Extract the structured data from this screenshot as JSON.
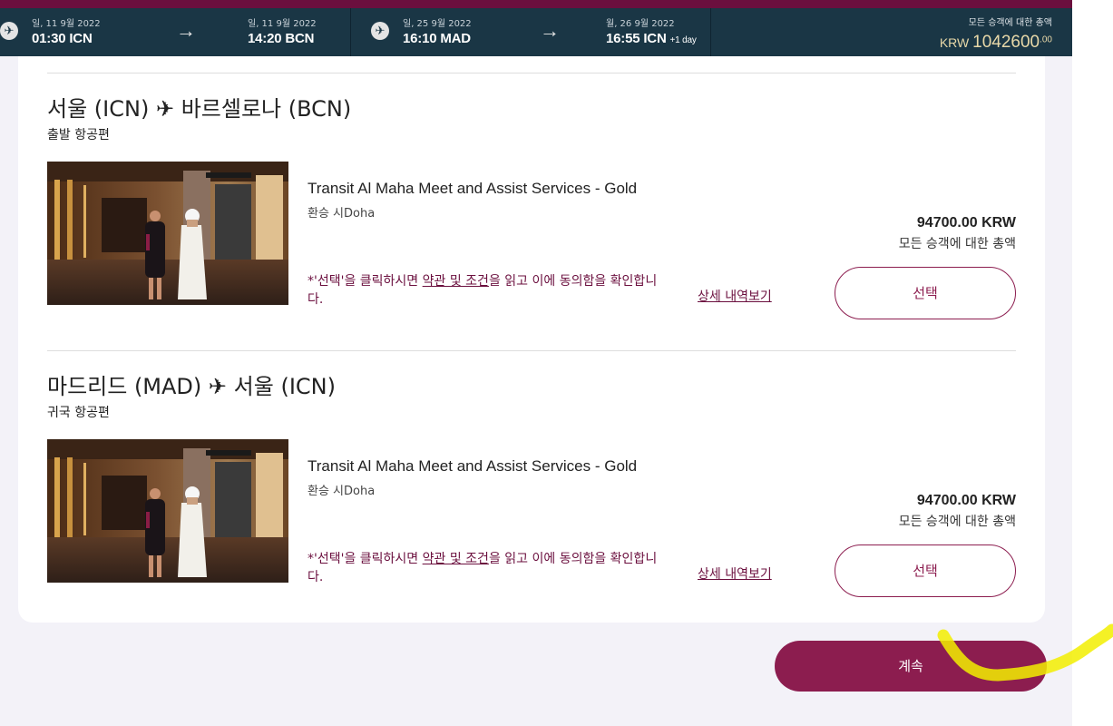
{
  "header": {
    "outbound": {
      "dep_date": "일, 11 9월 2022",
      "dep_time": "01:30",
      "dep_code": "ICN",
      "arr_date": "일, 11 9월 2022",
      "arr_time": "14:20",
      "arr_code": "BCN"
    },
    "inbound": {
      "dep_date": "일, 25 9월 2022",
      "dep_time": "16:10",
      "dep_code": "MAD",
      "arr_date": "월, 26 9월 2022",
      "arr_time": "16:55",
      "arr_code": "ICN",
      "day_offset": "+1 day"
    },
    "total_label": "모든 승객에 대한 총액",
    "currency": "KRW",
    "total_amount": "1042600",
    "total_decimals": ".00"
  },
  "sections": [
    {
      "route_from": "서울 (ICN)",
      "route_to": "바르셀로나 (BCN)",
      "subtitle": "출발 항공편",
      "service_name": "Transit Al Maha Meet and Assist Services - Gold",
      "service_location": "환승 시Doha",
      "price": "94700.00 KRW",
      "price_label": "모든 승객에 대한 총액",
      "terms_prefix": "*'선택'을 클릭하시면 ",
      "terms_link": "약관 및 조건",
      "terms_suffix": "을 읽고 이에 동의함을 확인합니다.",
      "details_label": "상세 내역보기",
      "select_label": "선택"
    },
    {
      "route_from": "마드리드 (MAD)",
      "route_to": "서울 (ICN)",
      "subtitle": "귀국 항공편",
      "service_name": "Transit Al Maha Meet and Assist Services - Gold",
      "service_location": "환승 시Doha",
      "price": "94700.00 KRW",
      "price_label": "모든 승객에 대한 총액",
      "terms_prefix": "*'선택'을 클릭하시면 ",
      "terms_link": "약관 및 조건",
      "terms_suffix": "을 읽고 이에 동의함을 확인합니다.",
      "details_label": "상세 내역보기",
      "select_label": "선택"
    }
  ],
  "continue_label": "계속",
  "colors": {
    "brand": "#8c1d4f",
    "header_bg": "#1a3645",
    "top_strip": "#6b0f3e",
    "gold_price": "#e8d8a8",
    "page_bg": "#f3f2f8"
  },
  "icons": {
    "route_plane": "airplane-icon",
    "depart": "plane-depart-icon",
    "return": "plane-return-icon",
    "arrow": "arrow-right-icon"
  }
}
